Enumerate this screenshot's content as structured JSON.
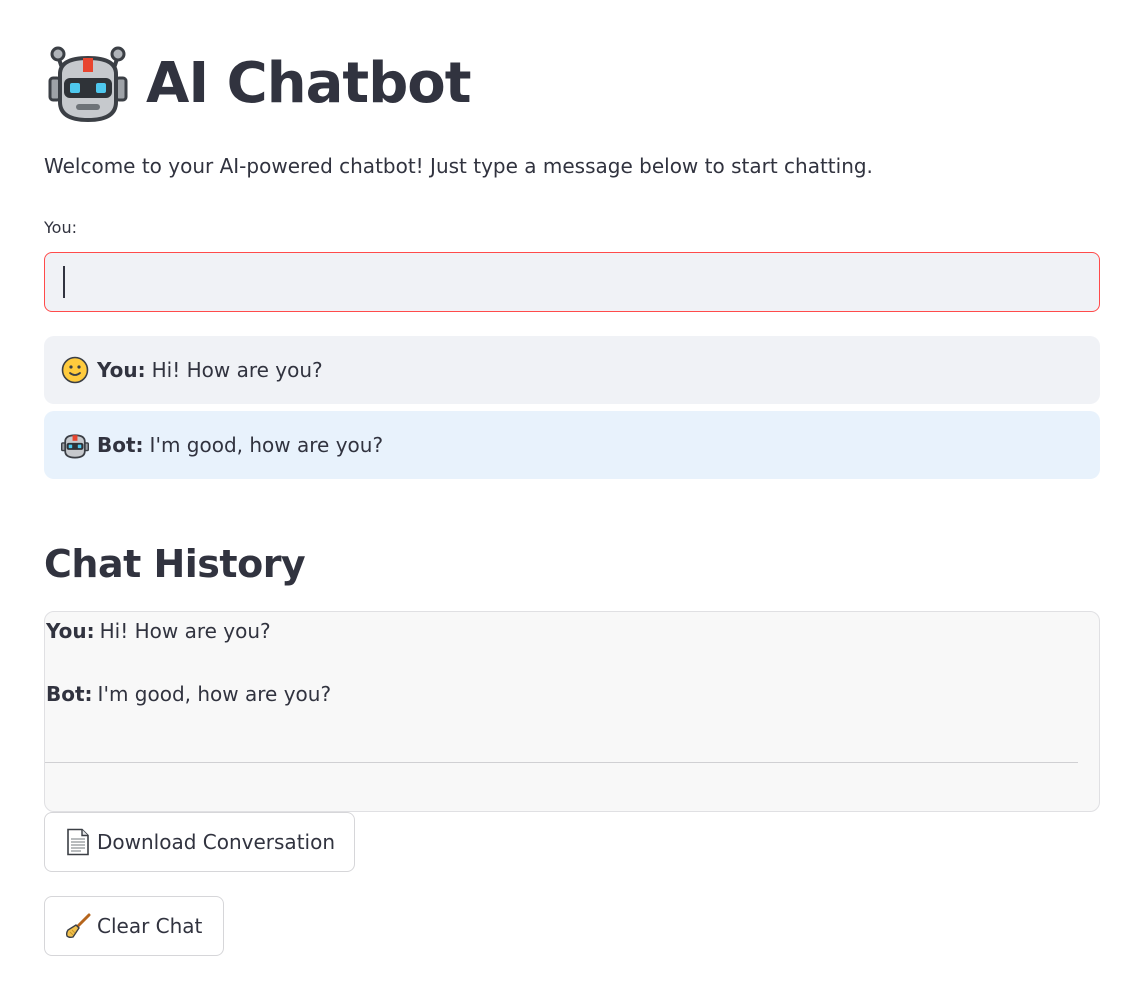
{
  "header": {
    "title": "AI Chatbot",
    "title_icon": "robot-face-icon"
  },
  "intro": {
    "welcome_text": "Welcome to your AI-powered chatbot! Just type a message below to start chatting."
  },
  "input": {
    "label": "You:",
    "value": "",
    "focused": true,
    "border_color": "#ff4b4b"
  },
  "messages": [
    {
      "role": "user",
      "icon": "slightly-smiling-face-icon",
      "speaker": "You:",
      "text": "Hi! How are you?",
      "background": "#f0f2f6"
    },
    {
      "role": "bot",
      "icon": "robot-face-icon",
      "speaker": "Bot:",
      "text": "I'm good, how are you?",
      "background": "#e8f2fc"
    }
  ],
  "history": {
    "title": "Chat History",
    "entries": [
      {
        "speaker": "You:",
        "text": "Hi! How are you?"
      },
      {
        "speaker": "Bot:",
        "text": "I'm good, how are you?"
      }
    ]
  },
  "actions": {
    "download_label": "Download Conversation",
    "download_icon": "page-document-icon",
    "clear_label": "Clear Chat",
    "clear_icon": "broom-icon"
  },
  "colors": {
    "text": "#31333f",
    "accent": "#ff4b4b",
    "input_bg": "#f0f2f6",
    "bot_bg": "#e8f2fc"
  }
}
